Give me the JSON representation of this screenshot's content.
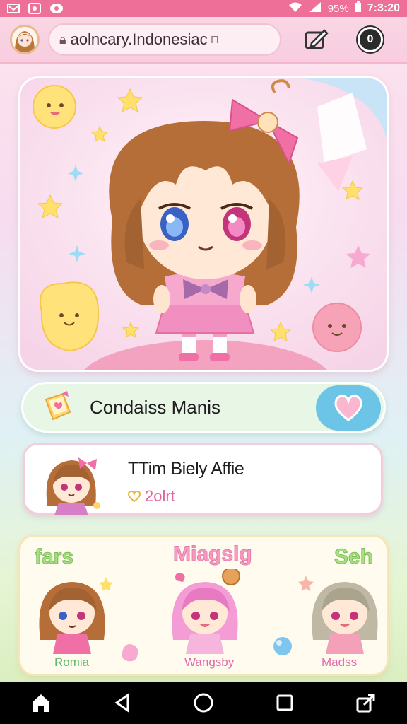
{
  "status_bar": {
    "battery": "95%",
    "time": "7:3:20"
  },
  "browser": {
    "url": "aolncary.Indonesiac",
    "icons": [
      "avatar",
      "lock-icon",
      "edit-icon",
      "tabs-icon"
    ],
    "tab_count": "0"
  },
  "hero": {
    "image": "chibi-girl-illustration"
  },
  "card_title": {
    "title": "Condaiss Manis",
    "icon": "book-icon",
    "action_icon": "heart-icon"
  },
  "profile_card": {
    "name": "TTim Biely Affie",
    "subtitle": "2olrt",
    "icon": "heart-icon"
  },
  "characters": {
    "headings": [
      "fars",
      "Miagslg",
      "Seh"
    ],
    "items": [
      {
        "label": "Romia"
      },
      {
        "label": "Wangsby"
      },
      {
        "label": "Madss"
      }
    ]
  },
  "colors": {
    "accent": "#ee6f98",
    "button_blue": "#6cc4e6",
    "pink": "#e3649c"
  },
  "nav": {
    "icons": [
      "home-icon",
      "back-icon",
      "circle-home-icon",
      "recents-icon",
      "share-icon"
    ]
  }
}
